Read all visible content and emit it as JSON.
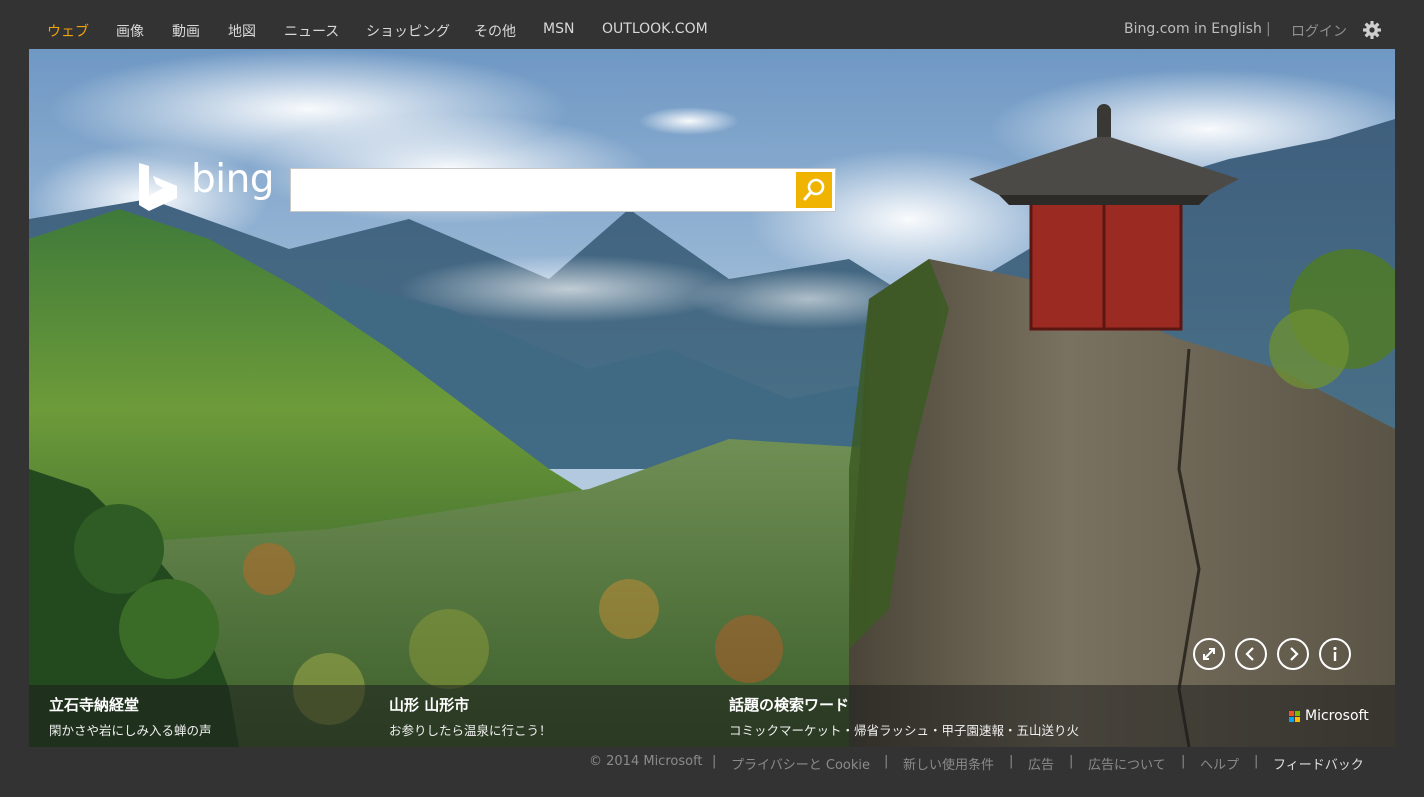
{
  "nav": {
    "items": [
      {
        "label": "ウェブ",
        "active": true
      },
      {
        "label": "画像"
      },
      {
        "label": "動画"
      },
      {
        "label": "地図"
      },
      {
        "label": "ニュース"
      },
      {
        "label": "ショッピング"
      },
      {
        "label": "その他"
      },
      {
        "label": "MSN"
      },
      {
        "label": "OUTLOOK.COM"
      }
    ],
    "english_link": "Bing.com in English",
    "separator": "|",
    "login": "ログイン",
    "settings_icon": "gear-icon"
  },
  "logo": {
    "text": "bing"
  },
  "search": {
    "value": "",
    "placeholder": "",
    "button_icon": "search-icon"
  },
  "hero_controls": [
    "expand-icon",
    "previous-icon",
    "next-icon",
    "info-icon"
  ],
  "captions": [
    {
      "title": "立石寺納経堂",
      "subtitle": "閑かさや岩にしみ入る蝉の声"
    },
    {
      "title": "山形 山形市",
      "subtitle": "お参りしたら温泉に行こう！"
    },
    {
      "title": "話題の検索ワード",
      "subtitle": "コミックマーケット・帰省ラッシュ・甲子園速報・五山送り火"
    }
  ],
  "microsoft": {
    "label": "Microsoft"
  },
  "footer": {
    "items": [
      {
        "label": "© 2014 Microsoft"
      },
      {
        "label": "プライバシーと Cookie"
      },
      {
        "label": "新しい使用条件"
      },
      {
        "label": "広告"
      },
      {
        "label": "広告について"
      },
      {
        "label": "ヘルプ"
      },
      {
        "label": "フィードバック",
        "strong": true
      }
    ],
    "separator": "|"
  },
  "colors": {
    "background": "#333333",
    "active_nav": "#f0a30a",
    "search_button": "#f0b300"
  }
}
